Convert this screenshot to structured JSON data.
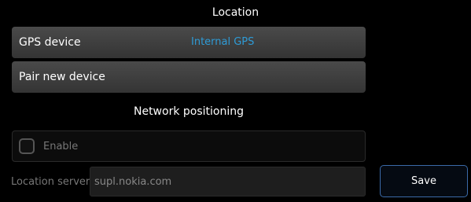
{
  "header": {
    "title": "Location"
  },
  "gps_device": {
    "label": "GPS device",
    "value": "Internal GPS"
  },
  "pair_device": {
    "label": "Pair new device"
  },
  "network_positioning": {
    "heading": "Network positioning",
    "enable": {
      "label": "Enable",
      "checked": false
    }
  },
  "location_server": {
    "label": "Location server",
    "value": "supl.nokia.com"
  },
  "actions": {
    "save_label": "Save"
  },
  "colors": {
    "accent": "#2e9bd6",
    "save_border": "#3b6aa8"
  }
}
